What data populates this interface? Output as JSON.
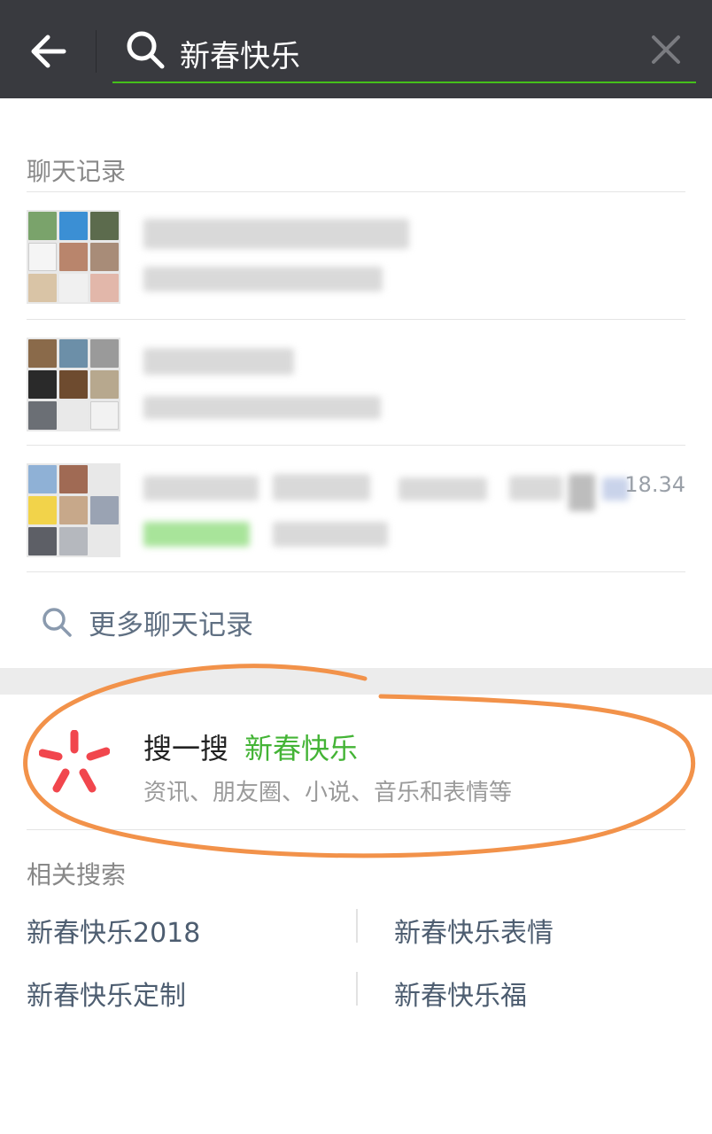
{
  "search": {
    "query": "新春快乐"
  },
  "chat_records": {
    "title": "聊天记录",
    "rows": [
      {
        "time": ""
      },
      {
        "time": ""
      },
      {
        "time": "18.34"
      }
    ],
    "more_label": "更多聊天记录"
  },
  "sousou": {
    "title": "搜一搜",
    "keyword": "新春快乐",
    "subtitle": "资讯、朋友圈、小说、音乐和表情等"
  },
  "related": {
    "title": "相关搜索",
    "items": [
      "新春快乐2018",
      "新春快乐表情",
      "新春快乐定制",
      "新春快乐福"
    ]
  },
  "colors": {
    "topbar": "#393a3f",
    "accent_green": "#44b436",
    "search_underline": "#45c01a",
    "sousou_star": "#f1464d",
    "annotation_orange": "#f2924a"
  }
}
